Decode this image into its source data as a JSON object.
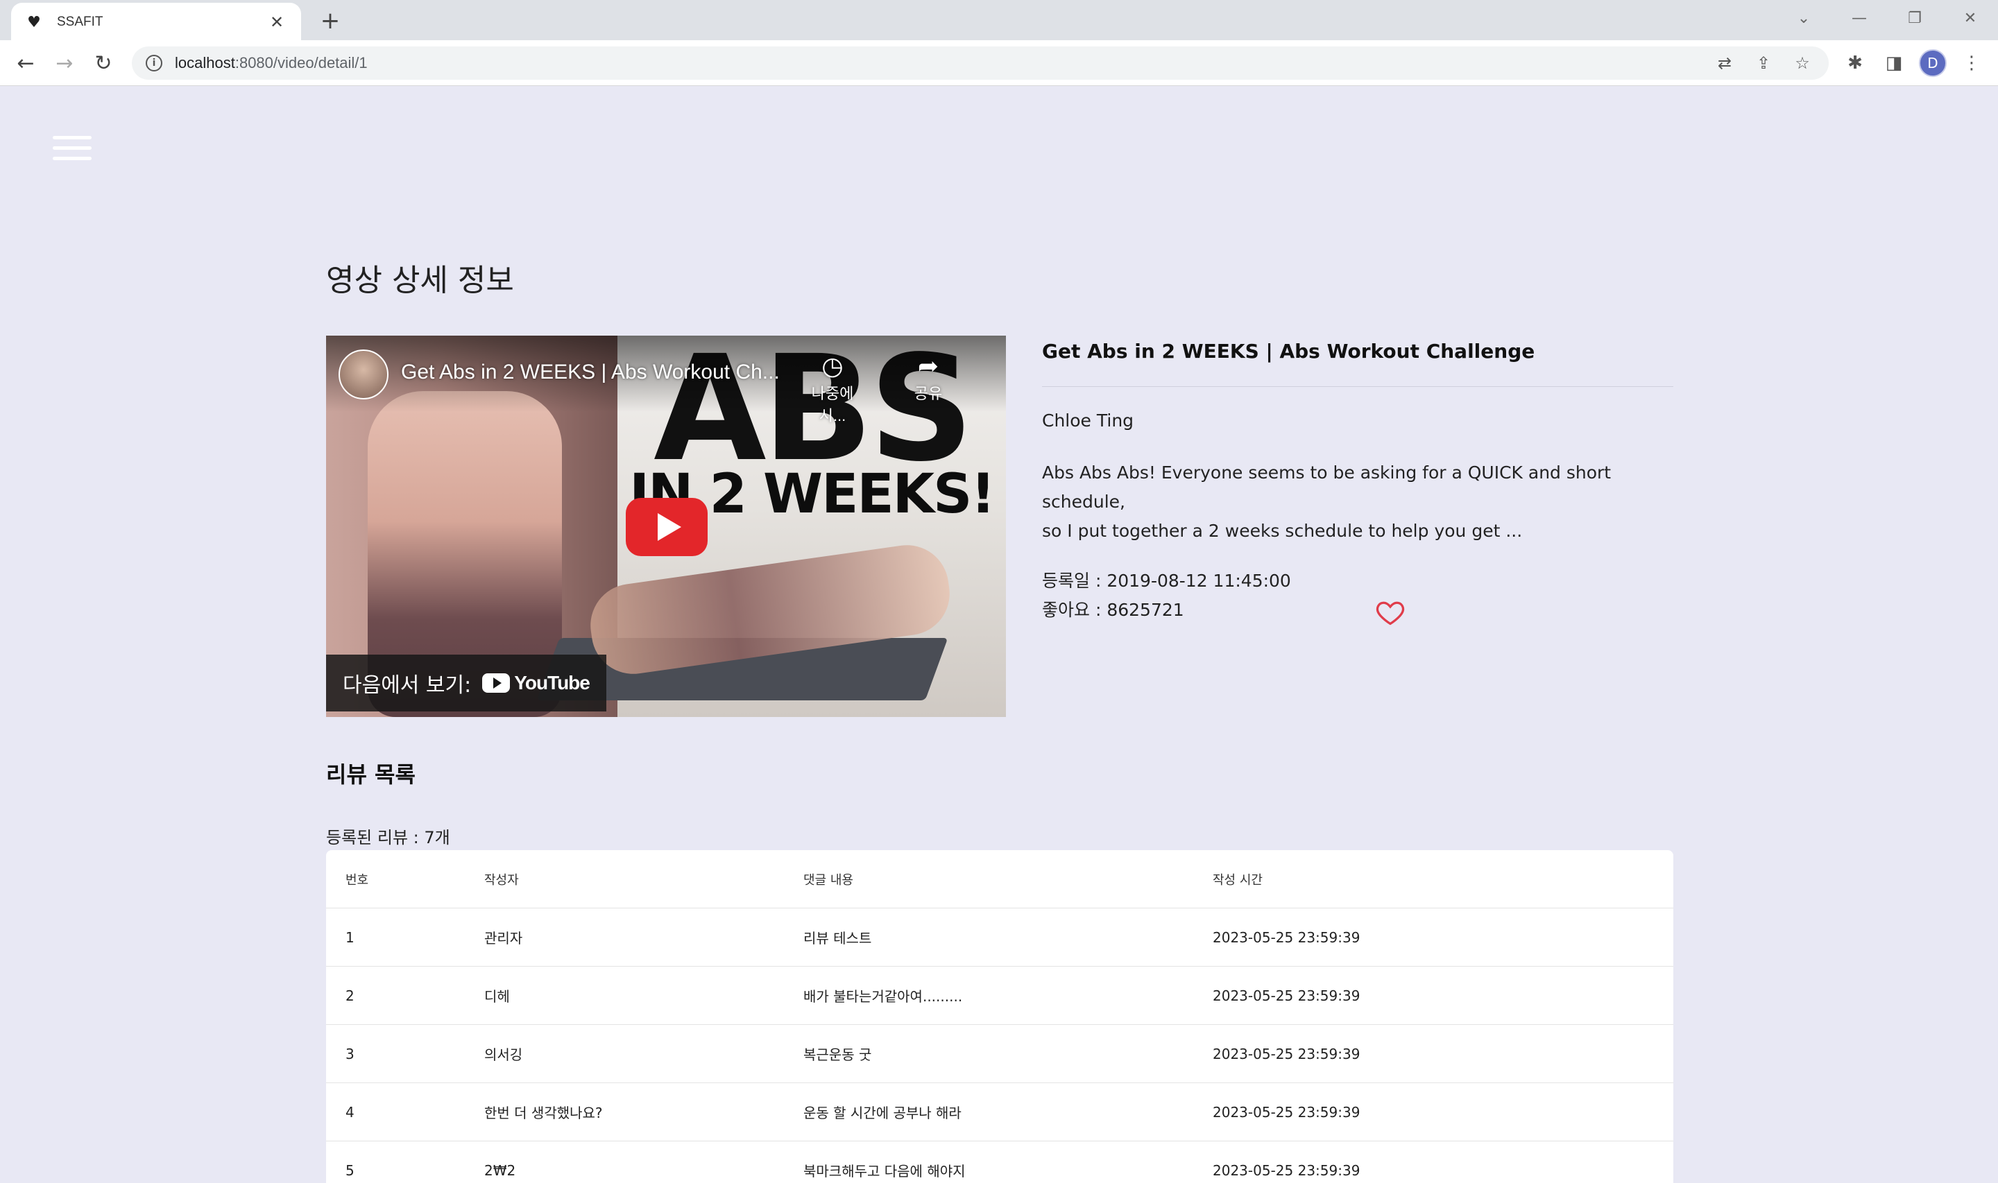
{
  "browser": {
    "tab_title": "SSAFIT",
    "url_host": "localhost",
    "url_path": ":8080/video/detail/1",
    "profile_initial": "D"
  },
  "page": {
    "title": "영상 상세 정보"
  },
  "video": {
    "player_title": "Get Abs in 2 WEEKS | Abs Workout Ch...",
    "thumb_text_big": "ABS",
    "thumb_text_small": "IN 2 WEEKS!",
    "watch_later_label": "나중에 시...",
    "share_label": "공유",
    "watch_on_label": "다음에서 보기:",
    "youtube_label": "YouTube"
  },
  "details": {
    "title": "Get Abs in 2 WEEKS | Abs Workout Challenge",
    "channel": "Chloe Ting",
    "description_line1": "Abs Abs Abs! Everyone seems to be asking for a QUICK and short schedule,",
    "description_line2": "so I put together a 2 weeks schedule to help you get ...",
    "registered": "등록일 : 2019-08-12 11:45:00",
    "likes": "좋아요 : 8625721",
    "heart_color": "#e03c4a"
  },
  "reviews": {
    "title": "리뷰 목록",
    "count_text": "등록된 리뷰 : 7개",
    "columns": [
      "번호",
      "작성자",
      "댓글 내용",
      "작성 시간"
    ],
    "rows": [
      [
        "1",
        "관리자",
        "리뷰 테스트",
        "2023-05-25 23:59:39"
      ],
      [
        "2",
        "디헤",
        "배가 불타는거같아여.........",
        "2023-05-25 23:59:39"
      ],
      [
        "3",
        "의서깅",
        "복근운동 굿",
        "2023-05-25 23:59:39"
      ],
      [
        "4",
        "한번 더 생각했나요?",
        "운동 할 시간에 공부나 해라",
        "2023-05-25 23:59:39"
      ],
      [
        "5",
        "2₩2",
        "북마크해두고 다음에 해야지",
        "2023-05-25 23:59:39"
      ]
    ]
  }
}
